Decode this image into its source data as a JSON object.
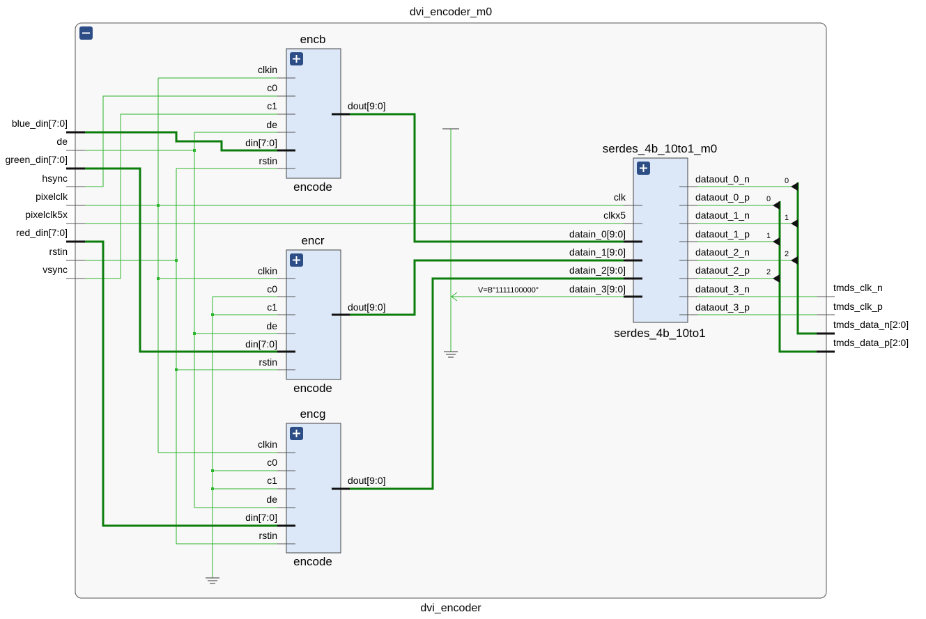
{
  "top": {
    "instance": "dvi_encoder_m0",
    "module": "dvi_encoder"
  },
  "inputs": [
    "blue_din[7:0]",
    "de",
    "green_din[7:0]",
    "hsync",
    "pixelclk",
    "pixelclk5x",
    "red_din[7:0]",
    "rstin",
    "vsync"
  ],
  "outputs": [
    "tmds_clk_n",
    "tmds_clk_p",
    "tmds_data_n[2:0]",
    "tmds_data_p[2:0]"
  ],
  "encb": {
    "instance": "encb",
    "module": "encode",
    "pins": [
      "clkin",
      "c0",
      "c1",
      "de",
      "din[7:0]",
      "rstin"
    ],
    "out": "dout[9:0]"
  },
  "encr": {
    "instance": "encr",
    "module": "encode",
    "pins": [
      "clkin",
      "c0",
      "c1",
      "de",
      "din[7:0]",
      "rstin"
    ],
    "out": "dout[9:0]"
  },
  "encg": {
    "instance": "encg",
    "module": "encode",
    "pins": [
      "clkin",
      "c0",
      "c1",
      "de",
      "din[7:0]",
      "rstin"
    ],
    "out": "dout[9:0]"
  },
  "serdes": {
    "instance": "serdes_4b_10to1_m0",
    "module": "serdes_4b_10to1",
    "inputs": [
      "clk",
      "clkx5",
      "datain_0[9:0]",
      "datain_1[9:0]",
      "datain_2[9:0]",
      "datain_3[9:0]"
    ],
    "outputs": [
      "dataout_0_n",
      "dataout_0_p",
      "dataout_1_n",
      "dataout_1_p",
      "dataout_2_n",
      "dataout_2_p",
      "dataout_3_n",
      "dataout_3_p"
    ]
  },
  "const_label": "V=B\"1111100000\"",
  "bus_indices": [
    "0",
    "0",
    "1",
    "1",
    "2",
    "2"
  ],
  "colors": {
    "wire": "#2db52d",
    "bus": "#0b7d0b",
    "block": "#dce8f7",
    "button": "#2d4d86"
  },
  "icons": {
    "collapse": "minus-icon",
    "expand": "plus-icon"
  }
}
